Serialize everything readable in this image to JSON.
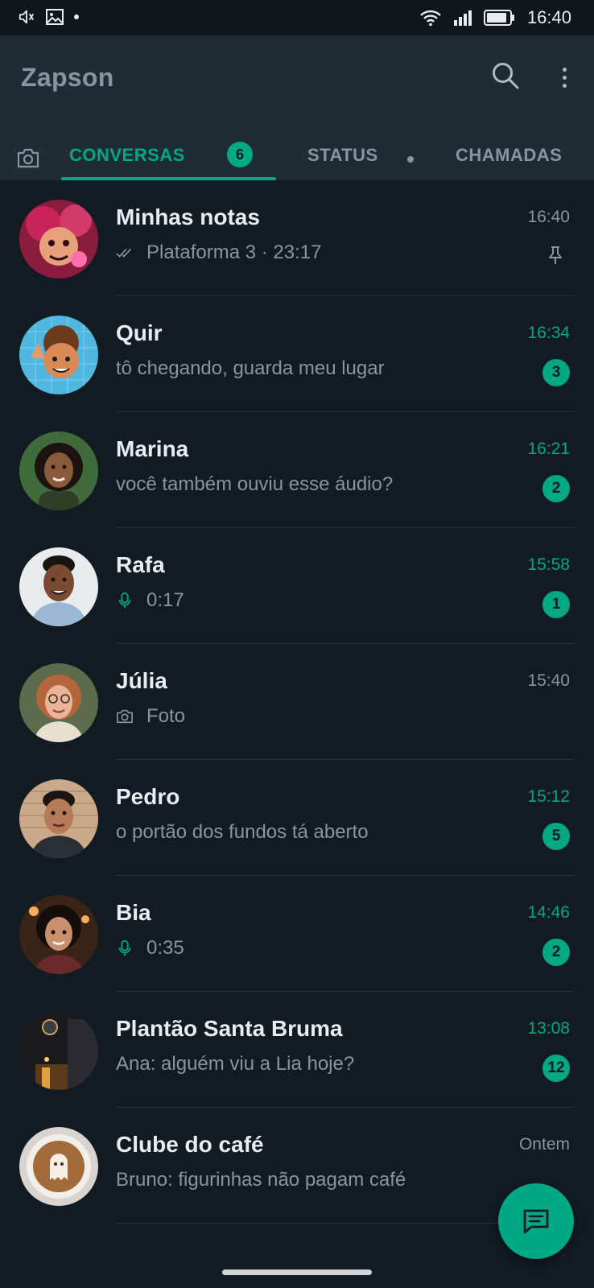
{
  "status_bar": {
    "time": "16:40",
    "icons": [
      "volume-icon",
      "image-icon",
      "wifi-icon",
      "signal-icon",
      "battery-icon"
    ]
  },
  "header": {
    "title": "Zapson",
    "actions": [
      "search-icon",
      "more-options-icon"
    ]
  },
  "tabs": [
    {
      "label": "CONVERSAS",
      "badge": "6",
      "active": true
    },
    {
      "label": "STATUS",
      "has_dot": true
    },
    {
      "label": "CHAMADAS"
    }
  ],
  "colors": {
    "accent": "#00a884",
    "background": "#121b22",
    "header": "#202c33",
    "secondary_text": "#8696a0"
  },
  "chats": [
    {
      "name": "Minhas notas",
      "time": "16:40",
      "preview": "Plataforma 3 · 23:17",
      "preview_icon": "double-check-icon",
      "pinned": true
    },
    {
      "name": "Quir",
      "time": "16:34",
      "preview": "tô chegando, guarda meu lugar",
      "unread": "3"
    },
    {
      "name": "Marina",
      "time": "16:21",
      "preview": "você também ouviu esse áudio?",
      "unread": "2"
    },
    {
      "name": "Rafa",
      "time": "15:58",
      "preview": "0:17",
      "preview_icon": "microphone-icon",
      "unread": "1"
    },
    {
      "name": "Júlia",
      "time": "15:40",
      "preview": "Foto",
      "preview_icon": "camera-icon"
    },
    {
      "name": "Pedro",
      "time": "15:12",
      "preview": "o portão dos fundos tá aberto",
      "unread": "5"
    },
    {
      "name": "Bia",
      "time": "14:46",
      "preview": "0:35",
      "preview_icon": "microphone-icon",
      "unread": "2"
    },
    {
      "name": "Plantão Santa Bruma",
      "time": "13:08",
      "preview": "Ana: alguém viu a Lia hoje?",
      "unread": "12"
    },
    {
      "name": "Clube do café",
      "time": "Ontem",
      "preview": "Bruno: figurinhas não pagam café"
    }
  ],
  "fab": {
    "icon": "new-chat-icon"
  }
}
